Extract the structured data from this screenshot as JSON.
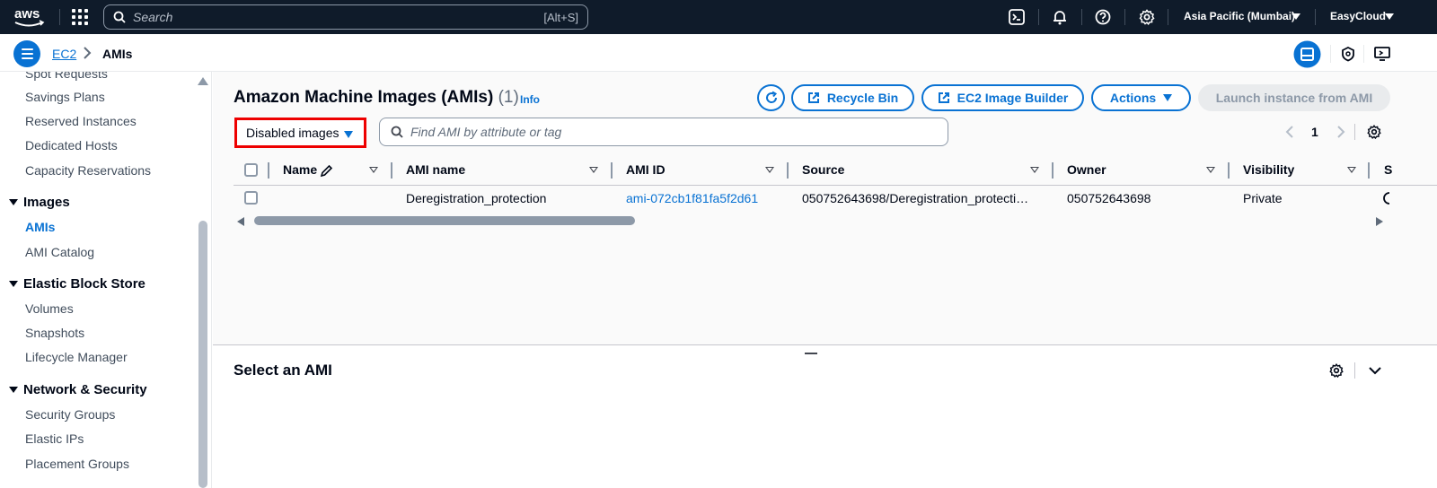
{
  "topnav": {
    "logo_text": "aws",
    "search_placeholder": "Search",
    "search_shortcut": "[Alt+S]",
    "region": "Asia Pacific (Mumbai)",
    "account": "EasyCloud"
  },
  "breadcrumb": {
    "parent": "EC2",
    "current": "AMIs"
  },
  "sidebar": {
    "items_top": [
      "Spot Requests",
      "Savings Plans",
      "Reserved Instances",
      "Dedicated Hosts",
      "Capacity Reservations"
    ],
    "sections": [
      {
        "title": "Images",
        "items": [
          "AMIs",
          "AMI Catalog"
        ],
        "active": "AMIs"
      },
      {
        "title": "Elastic Block Store",
        "items": [
          "Volumes",
          "Snapshots",
          "Lifecycle Manager"
        ]
      },
      {
        "title": "Network & Security",
        "items": [
          "Security Groups",
          "Elastic IPs",
          "Placement Groups"
        ]
      }
    ]
  },
  "main": {
    "title": "Amazon Machine Images (AMIs)",
    "count": "(1)",
    "info": "Info",
    "buttons": {
      "recycle_bin": "Recycle Bin",
      "image_builder": "EC2 Image Builder",
      "actions": "Actions",
      "launch": "Launch instance from AMI"
    },
    "filter_select": "Disabled images",
    "find_placeholder": "Find AMI by attribute or tag",
    "page_number": "1",
    "table": {
      "columns": [
        "Name",
        "AMI name",
        "AMI ID",
        "Source",
        "Owner",
        "Visibility",
        "S"
      ],
      "rows": [
        {
          "name": "",
          "ami_name": "Deregistration_protection",
          "ami_id": "ami-072cb1f81fa5f2d61",
          "source": "050752643698/Deregistration_protecti…",
          "owner": "050752643698",
          "visibility": "Private"
        }
      ]
    }
  },
  "split_panel": {
    "title": "Select an AMI"
  },
  "colors": {
    "nav_bg": "#0f1b2a",
    "accent": "#0972d3",
    "highlight": "#ee0000"
  }
}
